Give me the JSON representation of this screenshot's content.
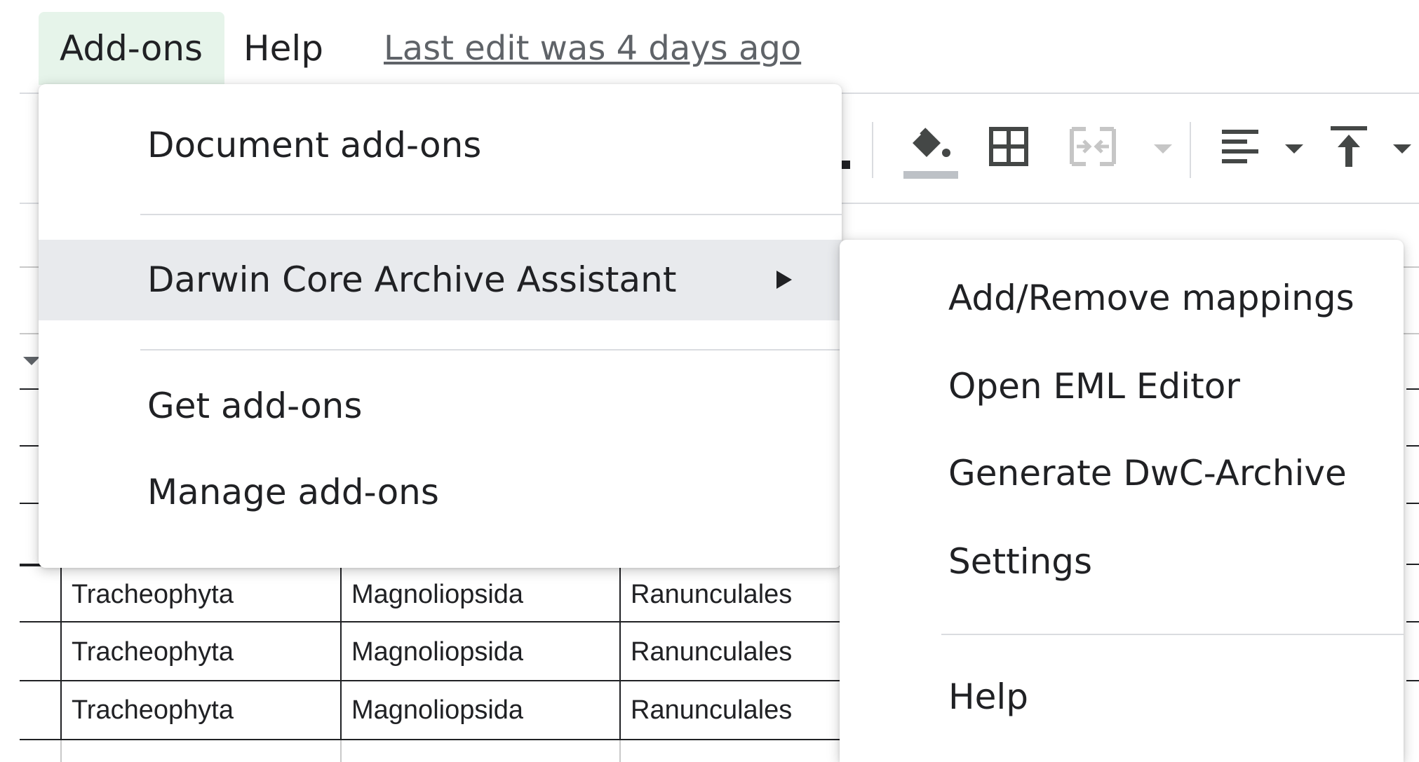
{
  "menubar": {
    "addons_label": "Add-ons",
    "help_label": "Help",
    "last_edit": "Last edit was 4 days ago"
  },
  "toolbar": {
    "icons": [
      "paint-bucket-icon",
      "borders-icon",
      "merge-cells-icon",
      "align-left-icon",
      "vertical-align-top-icon"
    ]
  },
  "addons_menu": {
    "items": [
      {
        "label": "Document add-ons"
      },
      {
        "label": "Darwin Core Archive Assistant",
        "has_submenu": true,
        "highlighted": true
      },
      {
        "label": "Get add-ons"
      },
      {
        "label": "Manage add-ons"
      }
    ]
  },
  "dwc_submenu": {
    "items": [
      {
        "label": "Add/Remove mappings"
      },
      {
        "label": "Open EML Editor"
      },
      {
        "label": "Generate DwC-Archive"
      },
      {
        "label": "Settings"
      },
      {
        "label": "Help"
      }
    ]
  },
  "sheet": {
    "rows": [
      [
        "Tracheophyta",
        "Magnoliopsida",
        "Ranunculales"
      ],
      [
        "Tracheophyta",
        "Magnoliopsida",
        "Ranunculales"
      ],
      [
        "Tracheophyta",
        "Magnoliopsida",
        "Ranunculales"
      ]
    ]
  },
  "colors": {
    "active_menu_tab": "#e6f4ea",
    "highlighted_item": "#e8eaed",
    "text": "#202124",
    "muted_text": "#5f6368"
  }
}
